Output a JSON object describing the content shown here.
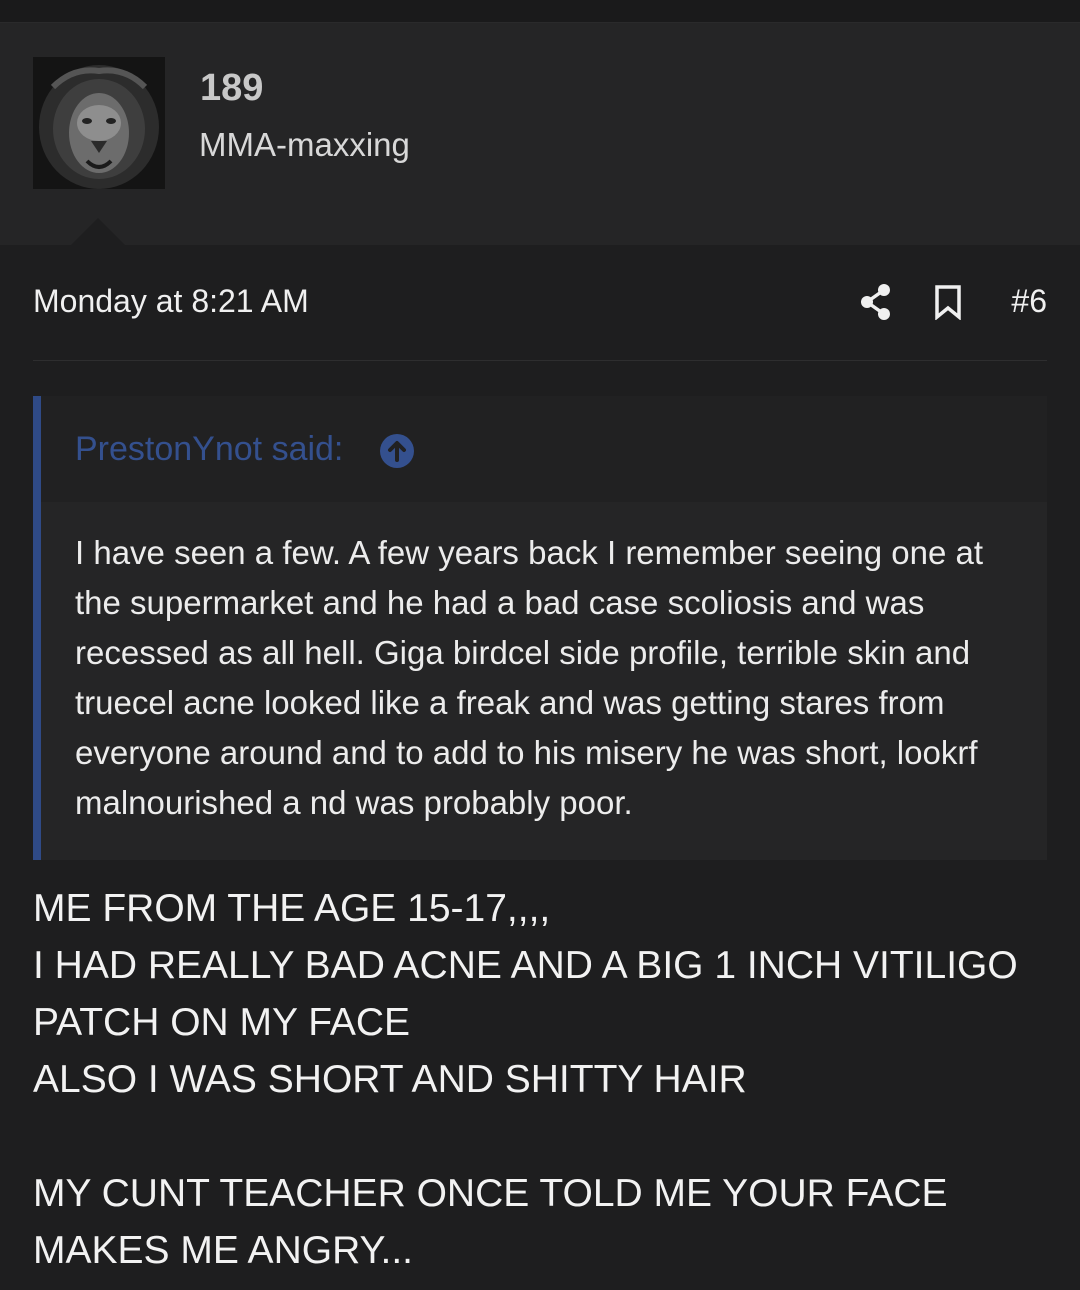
{
  "user": {
    "count": "189",
    "title": "MMA-maxxing",
    "avatar_icon": "lion-avatar"
  },
  "post": {
    "date": "Monday at 8:21 AM",
    "number": "#6",
    "share_icon": "share-icon",
    "bookmark_icon": "bookmark-icon"
  },
  "quote": {
    "author": "PrestonYnot said:",
    "jump_icon": "arrow-up-circle-icon",
    "body": "I have seen a few. A few years back I remember seeing one at the supermarket and he had a bad case scoliosis and was recessed as all hell. Giga birdcel side profile, terrible skin and truecel acne looked like a freak and was getting stares from everyone around and to add to his misery he was short, lookrf malnourished a nd was probably poor."
  },
  "message": {
    "lines": [
      "ME FROM THE AGE 15-17,,,,",
      "I HAD REALLY BAD ACNE AND A BIG 1 INCH VITILIGO",
      "PATCH ON MY FACE",
      "ALSO I WAS SHORT AND SHITTY HAIR",
      "",
      "MY CUNT TEACHER ONCE TOLD ME YOUR FACE",
      "MAKES ME ANGRY..."
    ]
  },
  "colors": {
    "background": "#1e1e1f",
    "panel": "#252526",
    "quote_accent": "#2f4a86",
    "quote_author": "#34508e"
  }
}
